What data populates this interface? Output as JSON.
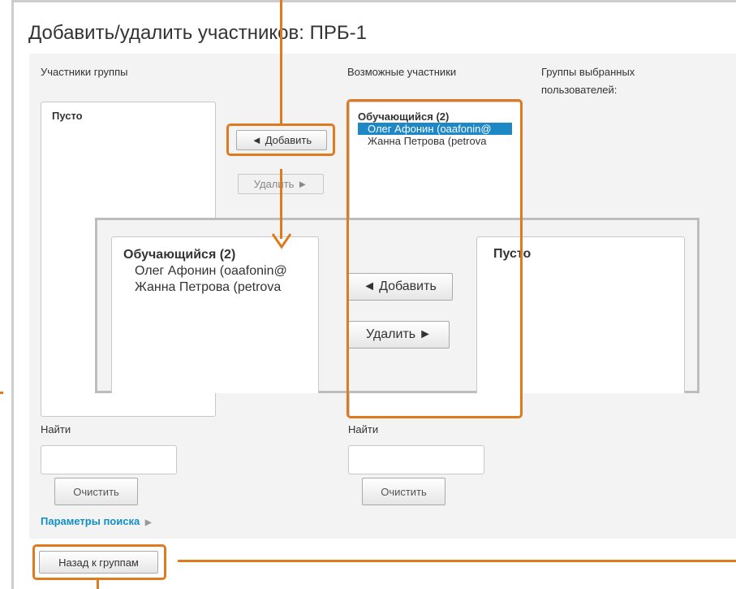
{
  "title": "Добавить/удалить участников: ПРБ-1",
  "columns": {
    "members_label": "Участники группы",
    "potential_label": "Возможные участники",
    "groups_label_line1": "Группы выбранных",
    "groups_label_line2": "пользователей:"
  },
  "members_list": {
    "empty_text": "Пусто"
  },
  "potential_list": {
    "group_header": "Обучающийся (2)",
    "options": [
      "Олег Афонин (oaafonin@",
      "Жанна Петрова (petrova"
    ],
    "selected_index": 0
  },
  "buttons": {
    "add": "Добавить",
    "remove": "Удалить",
    "add_arrow": "◄",
    "remove_arrow": "►",
    "clear": "Очистить",
    "back": "Назад к группам"
  },
  "search": {
    "label": "Найти",
    "value": ""
  },
  "search_options_link": "Параметры поиска",
  "zoom": {
    "left_group_header": "Обучающийся (2)",
    "left_options": [
      "Олег Афонин (oaafonin@",
      "Жанна Петрова (petrova"
    ],
    "right_empty_text": "Пусто",
    "add": "Добавить",
    "remove": "Удалить"
  },
  "colors": {
    "accent_orange": "#e07a1f",
    "selection_blue": "#1e88c7",
    "link_blue": "#0f8fc6"
  }
}
